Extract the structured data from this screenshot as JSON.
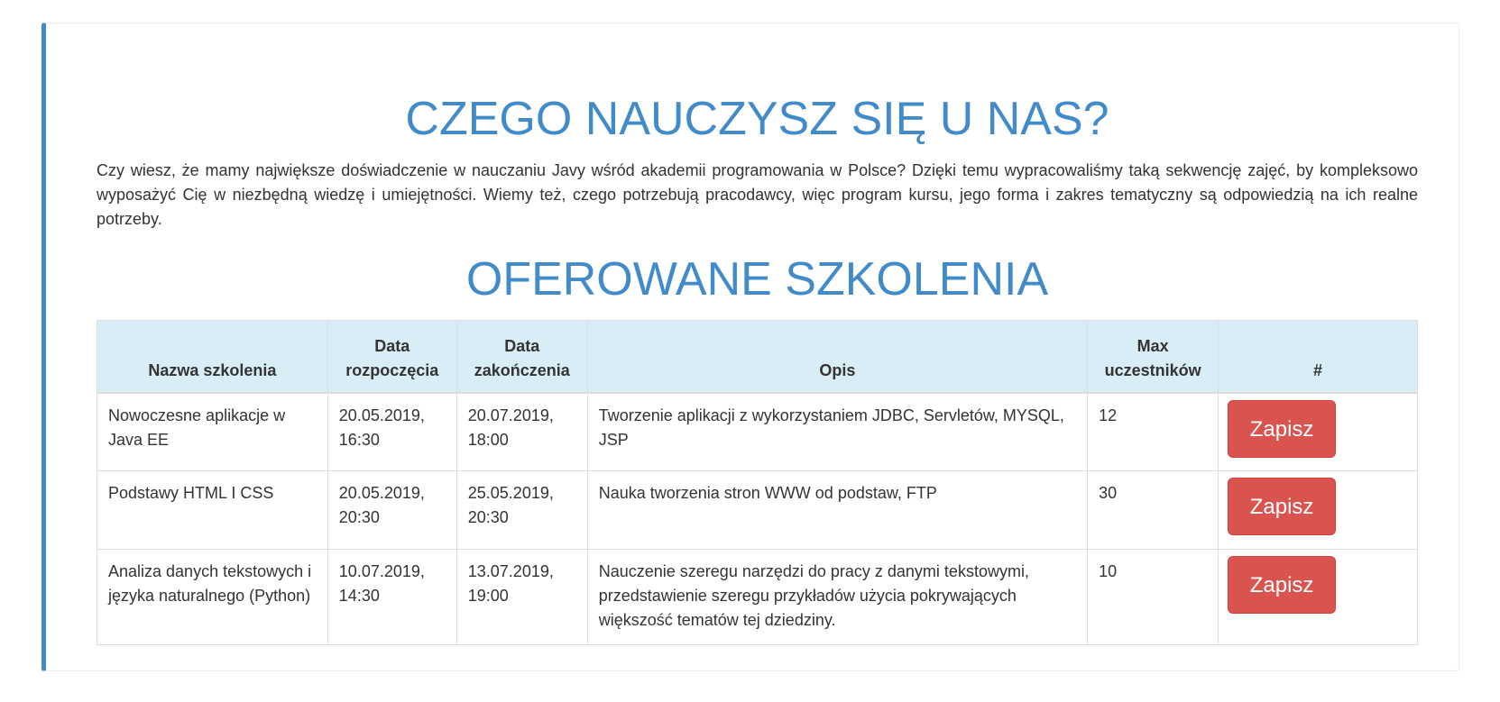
{
  "heading_main": "CZEGO NAUCZYSZ SIĘ U NAS?",
  "intro": "Czy wiesz, że mamy największe doświadczenie w nauczaniu Javy wśród akademii programowania w Polsce? Dzięki temu wypracowaliśmy taką sekwencję zajęć, by kompleksowo wyposażyć Cię w niezbędną wiedzę i umiejętności. Wiemy też, czego potrzebują pracodawcy, więc program kursu, jego forma i zakres tematyczny są odpowiedzią na ich realne potrzeby.",
  "heading_offers": "OFEROWANE SZKOLENIA",
  "colors": {
    "accent": "#428bca",
    "table_header_bg": "#d9edf7",
    "button_bg": "#d9534f"
  },
  "table": {
    "headers": {
      "name": "Nazwa szkolenia",
      "start_1": "Data",
      "start_2": "rozpoczęcia",
      "end_1": "Data",
      "end_2": "zakończenia",
      "desc": "Opis",
      "max_1": "Max",
      "max_2": "uczestników",
      "action": "#"
    },
    "rows": [
      {
        "name": "Nowoczesne aplikacje w Java EE",
        "start": "20.05.2019, 16:30",
        "end": "20.07.2019, 18:00",
        "desc": "Tworzenie aplikacji z wykorzystaniem JDBC, Servletów, MYSQL, JSP",
        "max": "12",
        "button": "Zapisz"
      },
      {
        "name": "Podstawy HTML I CSS",
        "start": "20.05.2019, 20:30",
        "end": "25.05.2019, 20:30",
        "desc": "Nauka tworzenia stron WWW od podstaw, FTP",
        "max": "30",
        "button": "Zapisz"
      },
      {
        "name": "Analiza danych tekstowych i języka naturalnego (Python)",
        "start": "10.07.2019, 14:30",
        "end": "13.07.2019, 19:00",
        "desc": "Nauczenie szeregu narzędzi do pracy z danymi tekstowymi, przedstawienie szeregu przykładów użycia pokrywających większość tematów tej dziedziny.",
        "max": "10",
        "button": "Zapisz"
      }
    ]
  }
}
